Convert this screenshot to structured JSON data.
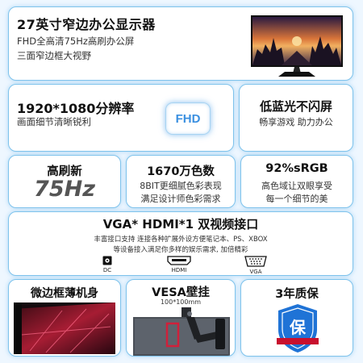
{
  "hero": {
    "title": "27英寸窄边办公显示器",
    "line1": "FHD全高清75Hz高刷办公屏",
    "line2": "三面窄边框大视野"
  },
  "resolution": {
    "title": "1920*1080分辨率",
    "sub": "画面细节清晰锐利",
    "badge": "FHD"
  },
  "blue_light": {
    "title": "低蓝光不闪屏",
    "sub": "畅享游戏 助力办公"
  },
  "refresh": {
    "title": "高刷新",
    "value": "75Hz"
  },
  "colors": {
    "title": "1670万色数",
    "line1": "8BIT更细腻色彩表现",
    "line2": "满足设计师色彩需求"
  },
  "srgb": {
    "title": "92%sRGB",
    "line1": "高色域让双眼享受",
    "line2": "每一个细节的美"
  },
  "ports": {
    "title": "VGA* HDMI*1 双视频接口",
    "line1": "丰富接口支持 连接各种扩展外设方便笔记本、PS、XBOX",
    "line2": "等设备接入满足你多样的娱乐需求, 加倍精彩",
    "items": [
      {
        "label": "DC",
        "icon": "dc-port-icon"
      },
      {
        "label": "HDMI",
        "icon": "hdmi-port-icon"
      },
      {
        "label": "VGA",
        "icon": "vga-port-icon"
      }
    ]
  },
  "slim": {
    "title": "微边框薄机身"
  },
  "vesa": {
    "title": "VESA壁挂",
    "sub": "100*100mm"
  },
  "warranty": {
    "title": "3年质保",
    "seal_char": "保"
  },
  "colors_theme": {
    "card_border": "#7fc3ec",
    "fhd_blue": "#3a8fe0",
    "seal_blue": "#1f73d6",
    "background": "#eef7ff"
  }
}
